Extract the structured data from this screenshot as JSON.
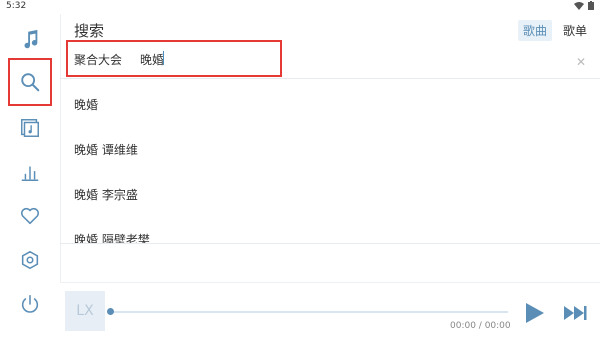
{
  "status": {
    "time": "5:32"
  },
  "sidebar": {
    "items": [
      {
        "name": "music-note-icon"
      },
      {
        "name": "search-icon",
        "active": true
      },
      {
        "name": "playlist-icon"
      },
      {
        "name": "chart-icon"
      },
      {
        "name": "heart-icon"
      },
      {
        "name": "settings-icon"
      },
      {
        "name": "power-icon"
      }
    ]
  },
  "header": {
    "title": "搜索",
    "tabs": [
      {
        "label": "歌曲",
        "active": true
      },
      {
        "label": "歌单",
        "active": false
      }
    ]
  },
  "search": {
    "source": "聚合大会",
    "query": "晚婚"
  },
  "results": [
    {
      "text": "晚婚"
    },
    {
      "text": "晚婚  谭维维"
    },
    {
      "text": "晚婚  李宗盛"
    },
    {
      "text": "晚婚  隔壁老樊"
    }
  ],
  "player": {
    "cover_text": "LX",
    "time": "00:00 / 00:00",
    "progress": 0
  },
  "colors": {
    "accent": "#5b8eb6",
    "highlight": "#e53935"
  }
}
